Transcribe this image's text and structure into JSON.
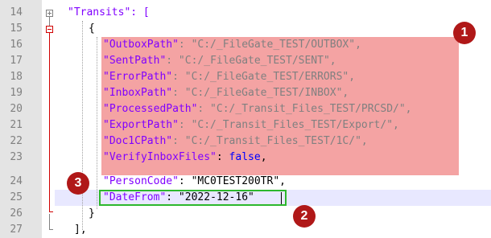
{
  "editor": {
    "lines": [
      {
        "num": "14",
        "text": "\"Transits\": ["
      },
      {
        "num": "15",
        "text": "{"
      },
      {
        "num": "16",
        "key": "\"OutboxPath\"",
        "rest": ": \"C:/_FileGate_TEST/OUTBOX\","
      },
      {
        "num": "17",
        "key": "\"SentPath\"",
        "rest": ": \"C:/_FileGate_TEST/SENT\","
      },
      {
        "num": "18",
        "key": "\"ErrorPath\"",
        "rest": ": \"C:/_FileGate_TEST/ERRORS\","
      },
      {
        "num": "19",
        "key": "\"InboxPath\"",
        "rest": ": \"C:/_FileGate_TEST/INBOX\","
      },
      {
        "num": "20",
        "key": "\"ProcessedPath\"",
        "rest": ": \"C:/_Transit_Files_TEST/PRCSD/\","
      },
      {
        "num": "21",
        "key": "\"ExportPath\"",
        "rest": ": \"C:/_Transit_Files_TEST/Export/\","
      },
      {
        "num": "22",
        "key": "\"Doc1CPath\"",
        "rest": ": \"C:/_Transit_Files_TEST/1C/\","
      },
      {
        "num": "23",
        "key": "\"VerifyInboxFiles\"",
        "rest_colon": ": ",
        "bool": "false",
        "comma": ","
      },
      {
        "num": "24",
        "key": "\"PersonCode\"",
        "rest": ": \"MC0TEST200TR\","
      },
      {
        "num": "25",
        "key": "\"DateFrom\"",
        "rest": ": \"2022-12-16\""
      },
      {
        "num": "26",
        "text": "}"
      },
      {
        "num": "27",
        "text": "],"
      }
    ]
  },
  "badges": {
    "one": "1",
    "two": "2",
    "three": "3"
  },
  "colors": {
    "highlight_red": "#f4a3a3",
    "highlight_green": "#2db82d",
    "badge": "#b01818",
    "key_purple": "#8000ff",
    "string_gray": "#808080",
    "bool_blue": "#0000ff"
  }
}
